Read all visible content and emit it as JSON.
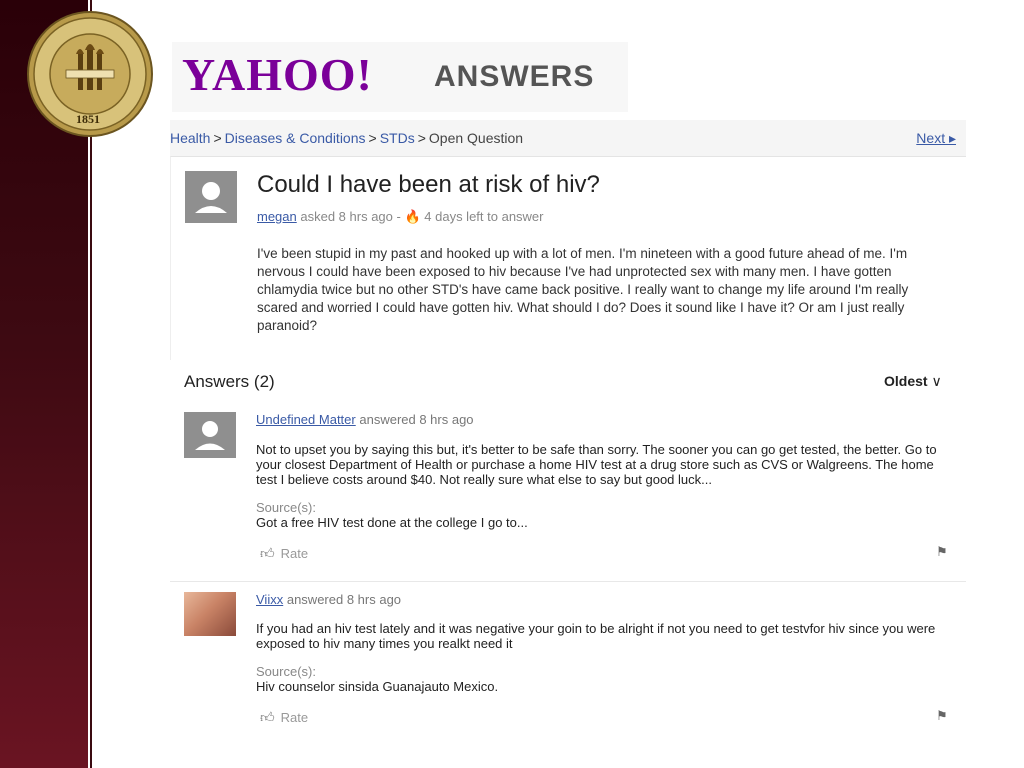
{
  "seal": {
    "text_top": "FLORIDA STATE UNIVERSITY",
    "year": "1851",
    "banners": [
      "VIRES",
      "ARTES",
      "MORES"
    ]
  },
  "logo": {
    "yahoo": "YAHOO!",
    "answers": "ANSWERS"
  },
  "breadcrumb": {
    "items": [
      "Health",
      "Diseases & Conditions",
      "STDs"
    ],
    "current": "Open Question",
    "sep": ">",
    "next": "Next ▸"
  },
  "question": {
    "title": "Could I have been at risk of hiv?",
    "author": "megan",
    "asked": "asked 8 hrs ago -",
    "time_left": "4 days left to answer",
    "body": "I've been stupid in my past and hooked up with a lot of men. I'm nineteen with a good future ahead of me. I'm nervous I could have been exposed to hiv because I've had unprotected sex with many men. I have gotten chlamydia twice but no other STD's have came back positive. I really want to change my life around I'm really scared and worried I could have gotten hiv. What should I do? Does it sound like I have it? Or am I just really paranoid?"
  },
  "answers_header": "Answers (2)",
  "sort_label": "Oldest",
  "answers": [
    {
      "author": "Undefined Matter",
      "answered": "answered 8 hrs ago",
      "text": "Not to upset you by saying this but, it's better to be safe than sorry. The sooner you can go get tested, the better. Go to your closest Department of Health or purchase a home HIV test at a drug store such as CVS or Walgreens. The home test I believe costs around $40. Not really sure what else to say but good luck...",
      "source_label": "Source(s):",
      "source": "Got a free HIV test done at the college I go to...",
      "rate": "Rate"
    },
    {
      "author": "Viixx",
      "answered": "answered 8 hrs ago",
      "text": "If you had an hiv test lately and it was negative your goin to be alright if not you need to get testvfor hiv since you were exposed to hiv many times you realkt need it",
      "source_label": "Source(s):",
      "source": "Hiv counselor sinsida Guanajauto Mexico.",
      "rate": "Rate"
    }
  ],
  "colors": {
    "band": "#3e0a12",
    "yahoo_purple": "#7b0099",
    "link_blue": "#3a5aa6"
  }
}
